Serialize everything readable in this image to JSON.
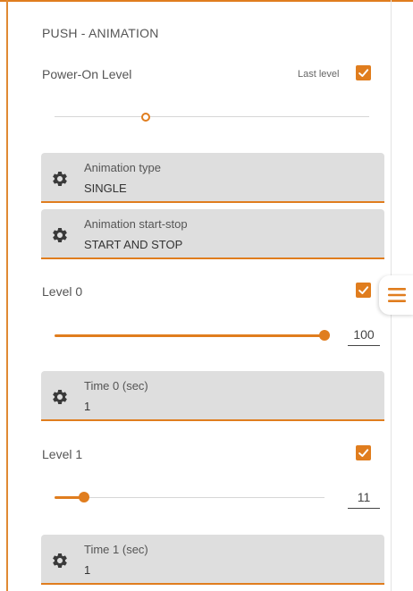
{
  "section": {
    "title": "PUSH - ANIMATION"
  },
  "power_on": {
    "label": "Power-On Level",
    "last_level_label": "Last level",
    "last_level_checked": true,
    "slider_fraction": 0.29
  },
  "animation_type": {
    "label": "Animation type",
    "value": "SINGLE",
    "icon": "gear-icon"
  },
  "animation_start_stop": {
    "label": "Animation start-stop",
    "value": "START AND STOP",
    "icon": "gear-icon"
  },
  "levels": [
    {
      "label": "Level 0",
      "checked": true,
      "value": "100",
      "slider_fraction": 1.0,
      "time": {
        "label": "Time 0 (sec)",
        "value": "1"
      }
    },
    {
      "label": "Level 1",
      "checked": true,
      "value": "11",
      "slider_fraction": 0.11,
      "time": {
        "label": "Time 1 (sec)",
        "value": "1"
      }
    }
  ],
  "menu": {
    "icon": "hamburger-menu-icon"
  },
  "colors": {
    "accent": "#e07d1e",
    "field_bg": "#dedede",
    "text": "#555555"
  }
}
